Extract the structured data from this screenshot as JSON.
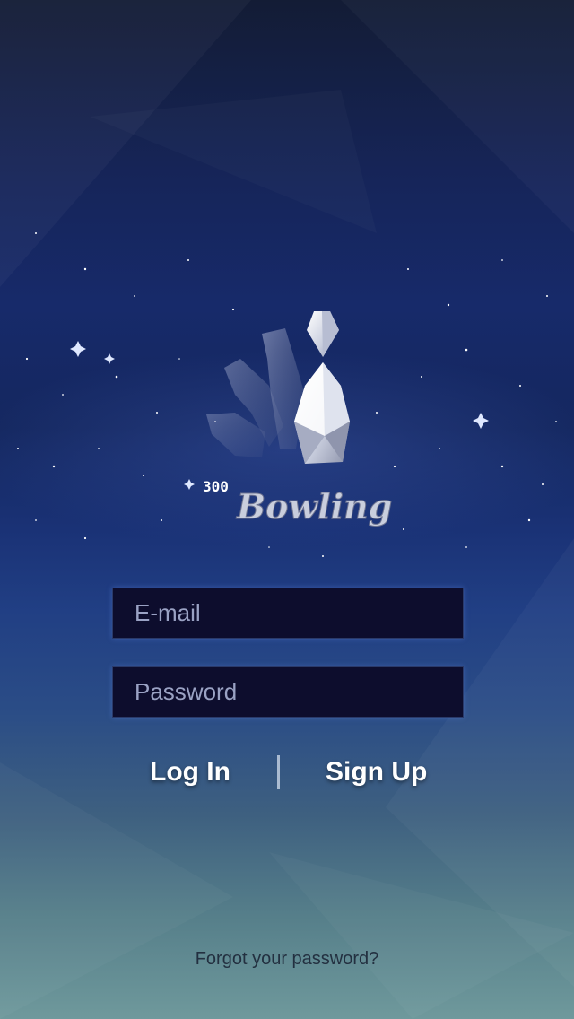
{
  "brand": {
    "number": "300",
    "name": "Bowling"
  },
  "login_form": {
    "email_placeholder": "E-mail",
    "password_placeholder": "Password"
  },
  "actions": {
    "login_label": "Log In",
    "signup_label": "Sign Up"
  },
  "forgot_password_label": "Forgot your password?",
  "colors": {
    "field_background": "#0d0d2d",
    "button_text": "#ffffff"
  }
}
